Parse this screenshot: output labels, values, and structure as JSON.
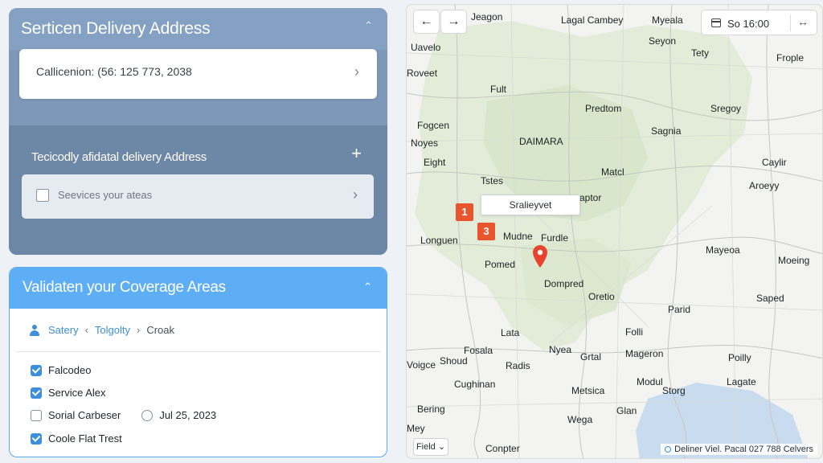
{
  "address_panel": {
    "title": "Serticen Delivery Address",
    "saved_address": "Callicenion: (56: 125 773, 2038",
    "additional_title": "Tecicodly afidatal delivery Address",
    "additional_placeholder": "Seevices your ateas"
  },
  "coverage_panel": {
    "title": "Validaten your Coverage Areas",
    "breadcrumb": [
      "Satery",
      "Tolgolty",
      "Croak"
    ],
    "options": [
      {
        "label": "Falcodeo",
        "checked": true
      },
      {
        "label": "Service Alex",
        "checked": true
      },
      {
        "label": "Sorial Carbeser",
        "checked": false
      },
      {
        "label": "Coole Flat Trest",
        "checked": true
      }
    ],
    "date": "Jul 25, 2023"
  },
  "map": {
    "time": "So 16:00",
    "tooltip": "Sralieyvet",
    "markers": [
      "1",
      "3"
    ],
    "layer_button": "Field",
    "attribution": "Deliner Viel. Pacal 027 788 Celvers",
    "places": [
      "Jeagon",
      "Lagal Cambey",
      "Myeala",
      "Uavelo",
      "Seyon",
      "Tety",
      "Frople",
      "Roveet",
      "Fult",
      "Predtom",
      "Sregoy",
      "Fogcen",
      "Sagnia",
      "Noyes",
      "DAIMARA",
      "Eight",
      "Matcl",
      "Caylir",
      "Aroeyy",
      "Tstes",
      "aptor",
      "Longuen",
      "Mudne",
      "Furdle",
      "Mayeoa",
      "Moeing",
      "Pomed",
      "Dompred",
      "Oretio",
      "Saped",
      "Parid",
      "Lata",
      "Folli",
      "Fosala",
      "Nyea",
      "Grtal",
      "Mageron",
      "Poilly",
      "Voigce",
      "Shoud",
      "Radis",
      "Cughinan",
      "Modul",
      "Lagate",
      "Metsica",
      "Storg",
      "Bering",
      "Glan",
      "Mey",
      "Wega",
      "Conpter"
    ]
  }
}
